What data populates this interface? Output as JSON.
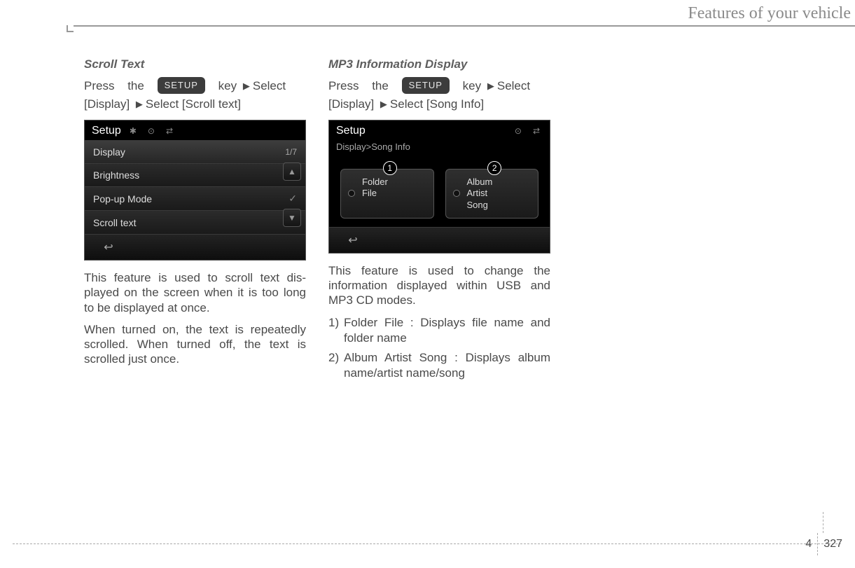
{
  "header": {
    "title": "Features of your vehicle"
  },
  "col1": {
    "heading": "Scroll Text",
    "press": {
      "p1": "Press",
      "p2": "the",
      "btn": "SETUP",
      "p3": "key",
      "p4": "Select",
      "line2a": "[Display]",
      "line2b": "Select [Scroll text]"
    },
    "screen": {
      "title": "Setup",
      "rows": {
        "display": "Display",
        "display_count": "1/7",
        "brightness": "Brightness",
        "popup": "Pop-up Mode",
        "scroll": "Scroll text"
      }
    },
    "para1": "This feature is used to scroll text dis­played on the screen when it is too long to be displayed at once.",
    "para2": "When turned on, the text is repeat­edly scrolled. When turned off, the text is scrolled just once."
  },
  "col2": {
    "heading": "MP3 Information Display",
    "press": {
      "p1": "Press",
      "p2": "the",
      "btn": "SETUP",
      "p3": "key",
      "p4": "Select",
      "line2a": "[Display]",
      "line2b": "Select [Song Info]"
    },
    "screen": {
      "title": "Setup",
      "sub": "Display>Song Info",
      "opt1a": "Folder",
      "opt1b": "File",
      "opt2a": "Album",
      "opt2b": "Artist",
      "opt2c": "Song",
      "b1": "1",
      "b2": "2"
    },
    "para1": "This feature is used to change the information displayed within USB and MP3 CD modes.",
    "list": {
      "n1": "1)",
      "t1": "Folder File : Displays file name and folder name",
      "n2": "2)",
      "t2": "Album Artist Song : Displays album name/artist name/song"
    }
  },
  "footer": {
    "section": "4",
    "page": "327"
  }
}
